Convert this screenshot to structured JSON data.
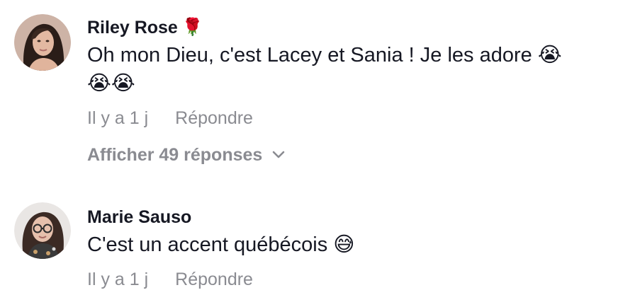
{
  "comments": [
    {
      "username": "Riley Rose",
      "username_emoji": "🌹",
      "text_line1": "Oh mon Dieu, c'est Lacey et Sania ! Je les adore 😭",
      "text_line2": "😭😭",
      "time": "Il y a 1 j",
      "reply_label": "Répondre",
      "view_replies_label": "Afficher 49 réponses"
    },
    {
      "username": "Marie Sauso",
      "text_line1": "C'est un accent québécois 😅",
      "time": "Il y a 1 j",
      "reply_label": "Répondre"
    }
  ],
  "colors": {
    "primary_text": "#161823",
    "secondary_text": "#8a8b91",
    "background": "#ffffff"
  },
  "icons": [
    "chevron-down-icon"
  ]
}
